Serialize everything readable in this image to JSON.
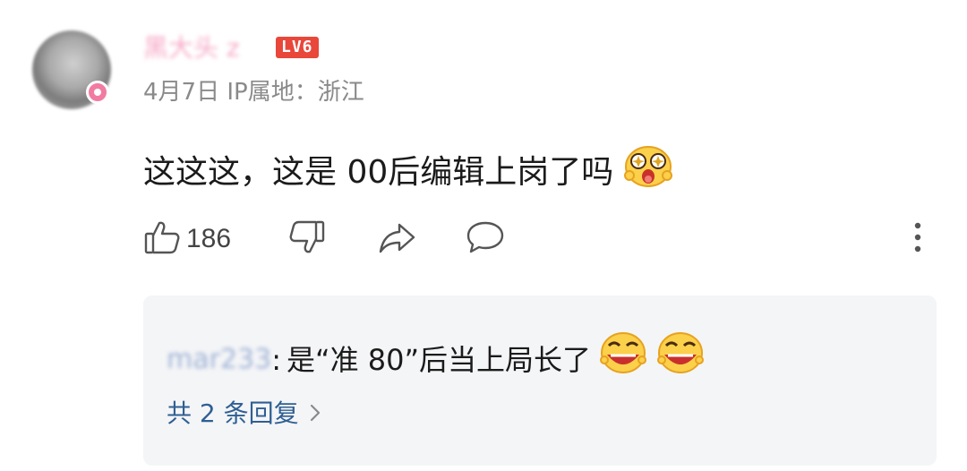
{
  "comment": {
    "username": "黑大头 z",
    "level": "LV6",
    "date": "4月7日",
    "ip_location": "IP属地：浙江",
    "text": "这这这，这是 00后编辑上岗了吗",
    "like_count": "186"
  },
  "reply": {
    "username": "mar233",
    "colon": ":",
    "text": "是“准 80”后当上局长了",
    "more_replies": "共 2 条回复"
  }
}
